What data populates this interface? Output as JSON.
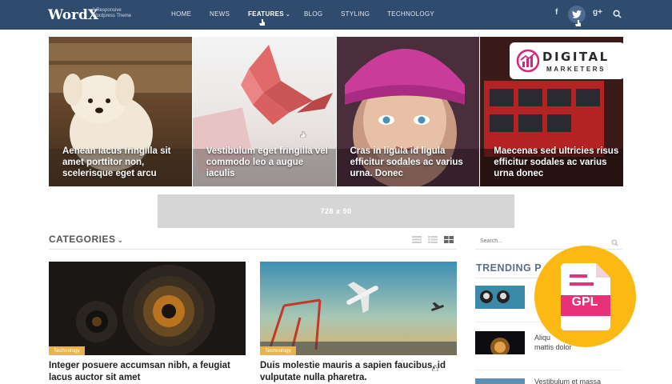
{
  "site": {
    "logo": "WordX",
    "tagline": "A Responsive Wordpress Theme"
  },
  "nav": {
    "items": [
      "HOME",
      "NEWS",
      "FEATURES",
      "BLOG",
      "STYLING",
      "TECHNOLOGY"
    ],
    "active": "FEATURES",
    "social": {
      "facebook": "f",
      "google": "g+"
    }
  },
  "slides": [
    {
      "title": "Aenean lacus fringilla sit amet porttitor non, scelerisque eget arcu"
    },
    {
      "title": "Vestibulum eget fringilla vel commodo leo a augue iaculis"
    },
    {
      "title": "Cras in ligula id ligula efficitur sodales ac varius urna. Donec"
    },
    {
      "title": "Maecenas sed ultricies risus efficitur sodales ac varius urna donec"
    }
  ],
  "ad": {
    "label": "728 x 90"
  },
  "categories": {
    "heading": "CATEGORIES",
    "cards": [
      {
        "tag": "Technology",
        "title": "Integer posuere accumsan nibh, a feugiat lacus auctor sit amet"
      },
      {
        "tag": "Technology",
        "title": "Duis molestie mauris a sapien faucibus, id vulputate nulla pharetra."
      }
    ]
  },
  "sidebar": {
    "search_placeholder": "Search...",
    "trending_heading": "TRENDING P",
    "items": [
      {
        "text": ""
      },
      {
        "text": "Aliqu\nmattis dolor"
      },
      {
        "text": "Vestibulum et massa"
      }
    ]
  },
  "overlays": {
    "digital_marketers": {
      "title": "DIGITAL",
      "subtitle": "MARKETERS"
    },
    "gpl": {
      "label": "GPL"
    }
  },
  "colors": {
    "nav_bg": "#2f4b6e",
    "tag_bg": "#e8b34b",
    "gpl_bg": "#fdb913",
    "dm_accent": "#d6247c"
  }
}
